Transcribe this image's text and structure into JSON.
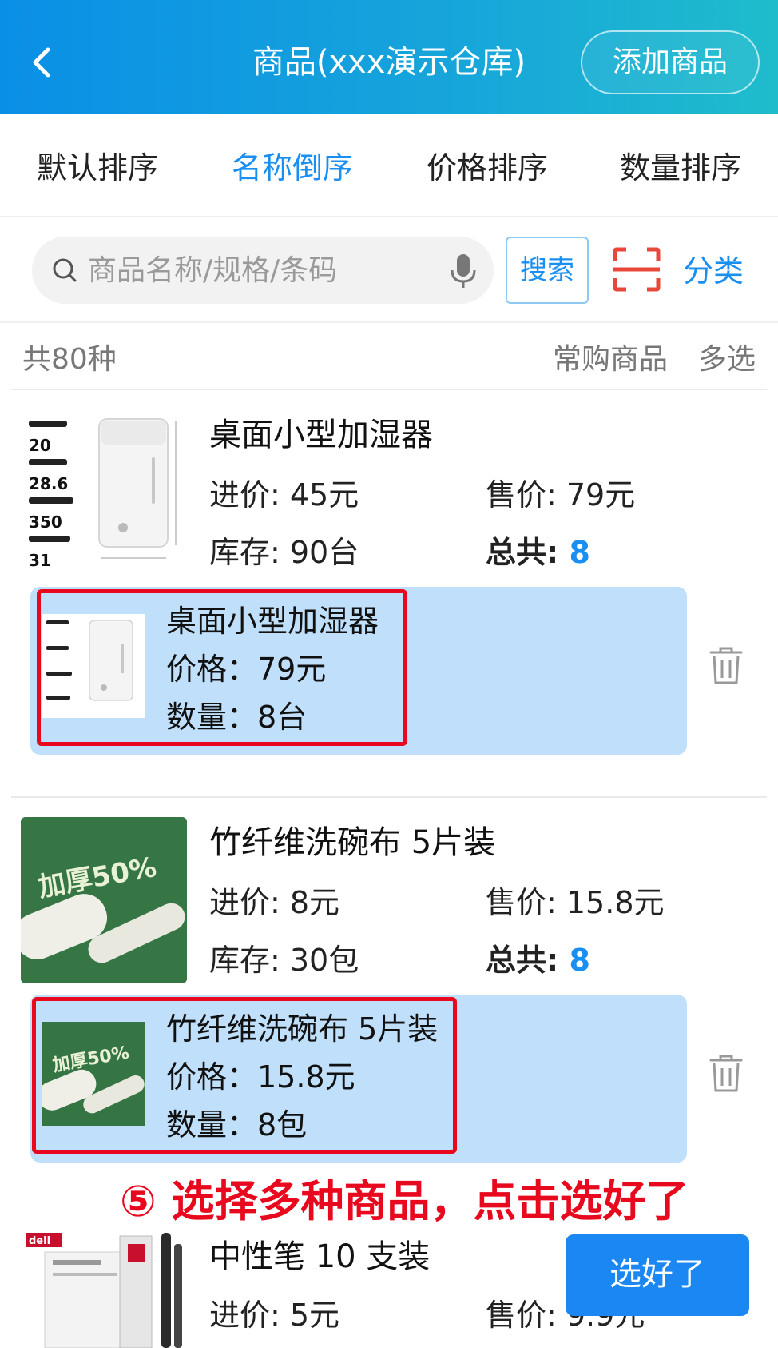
{
  "header": {
    "title": "商品(xxx演示仓库)",
    "add_button": "添加商品"
  },
  "sort_tabs": [
    {
      "label": "默认排序",
      "active": false
    },
    {
      "label": "名称倒序",
      "active": true
    },
    {
      "label": "价格排序",
      "active": false
    },
    {
      "label": "数量排序",
      "active": false
    }
  ],
  "search": {
    "placeholder": "商品名称/规格/条码",
    "button": "搜索",
    "category": "分类"
  },
  "list_header": {
    "count": "共80种",
    "frequent": "常购商品",
    "multi_select": "多选"
  },
  "products": [
    {
      "name": "桌面小型加湿器",
      "cost": "进价: 45元",
      "price": "售价: 79元",
      "stock": "库存: 90台",
      "total_label": "总共: ",
      "total_value": "8",
      "thumb_labels": [
        "20",
        "28.6",
        "350",
        "31"
      ],
      "selected": {
        "name": "桌面小型加湿器",
        "price": "价格：79元",
        "qty": "数量：8台"
      }
    },
    {
      "name": "竹纤维洗碗布   5片装",
      "cost": "进价: 8元",
      "price": "售价: 15.8元",
      "stock": "库存: 30包",
      "total_label": "总共: ",
      "total_value": "8",
      "thumb_labels": [
        "加厚50%"
      ],
      "selected": {
        "name": "竹纤维洗碗布  5片装",
        "price": "价格：15.8元",
        "qty": "数量：8包"
      }
    },
    {
      "name": "中性笔   10 支装",
      "cost": "进价: 5元",
      "price": "售价: 9.9元",
      "thumb_labels": [
        "deli"
      ]
    }
  ],
  "annotation": "⑤ 选择多种商品，点击选好了",
  "done_button": "选好了",
  "colors": {
    "header_start": "#0a8fe6",
    "header_end": "#1fbccc",
    "accent": "#1a8ff2",
    "selected_bg": "#bfdffa",
    "annotation_red": "#e8091e"
  }
}
